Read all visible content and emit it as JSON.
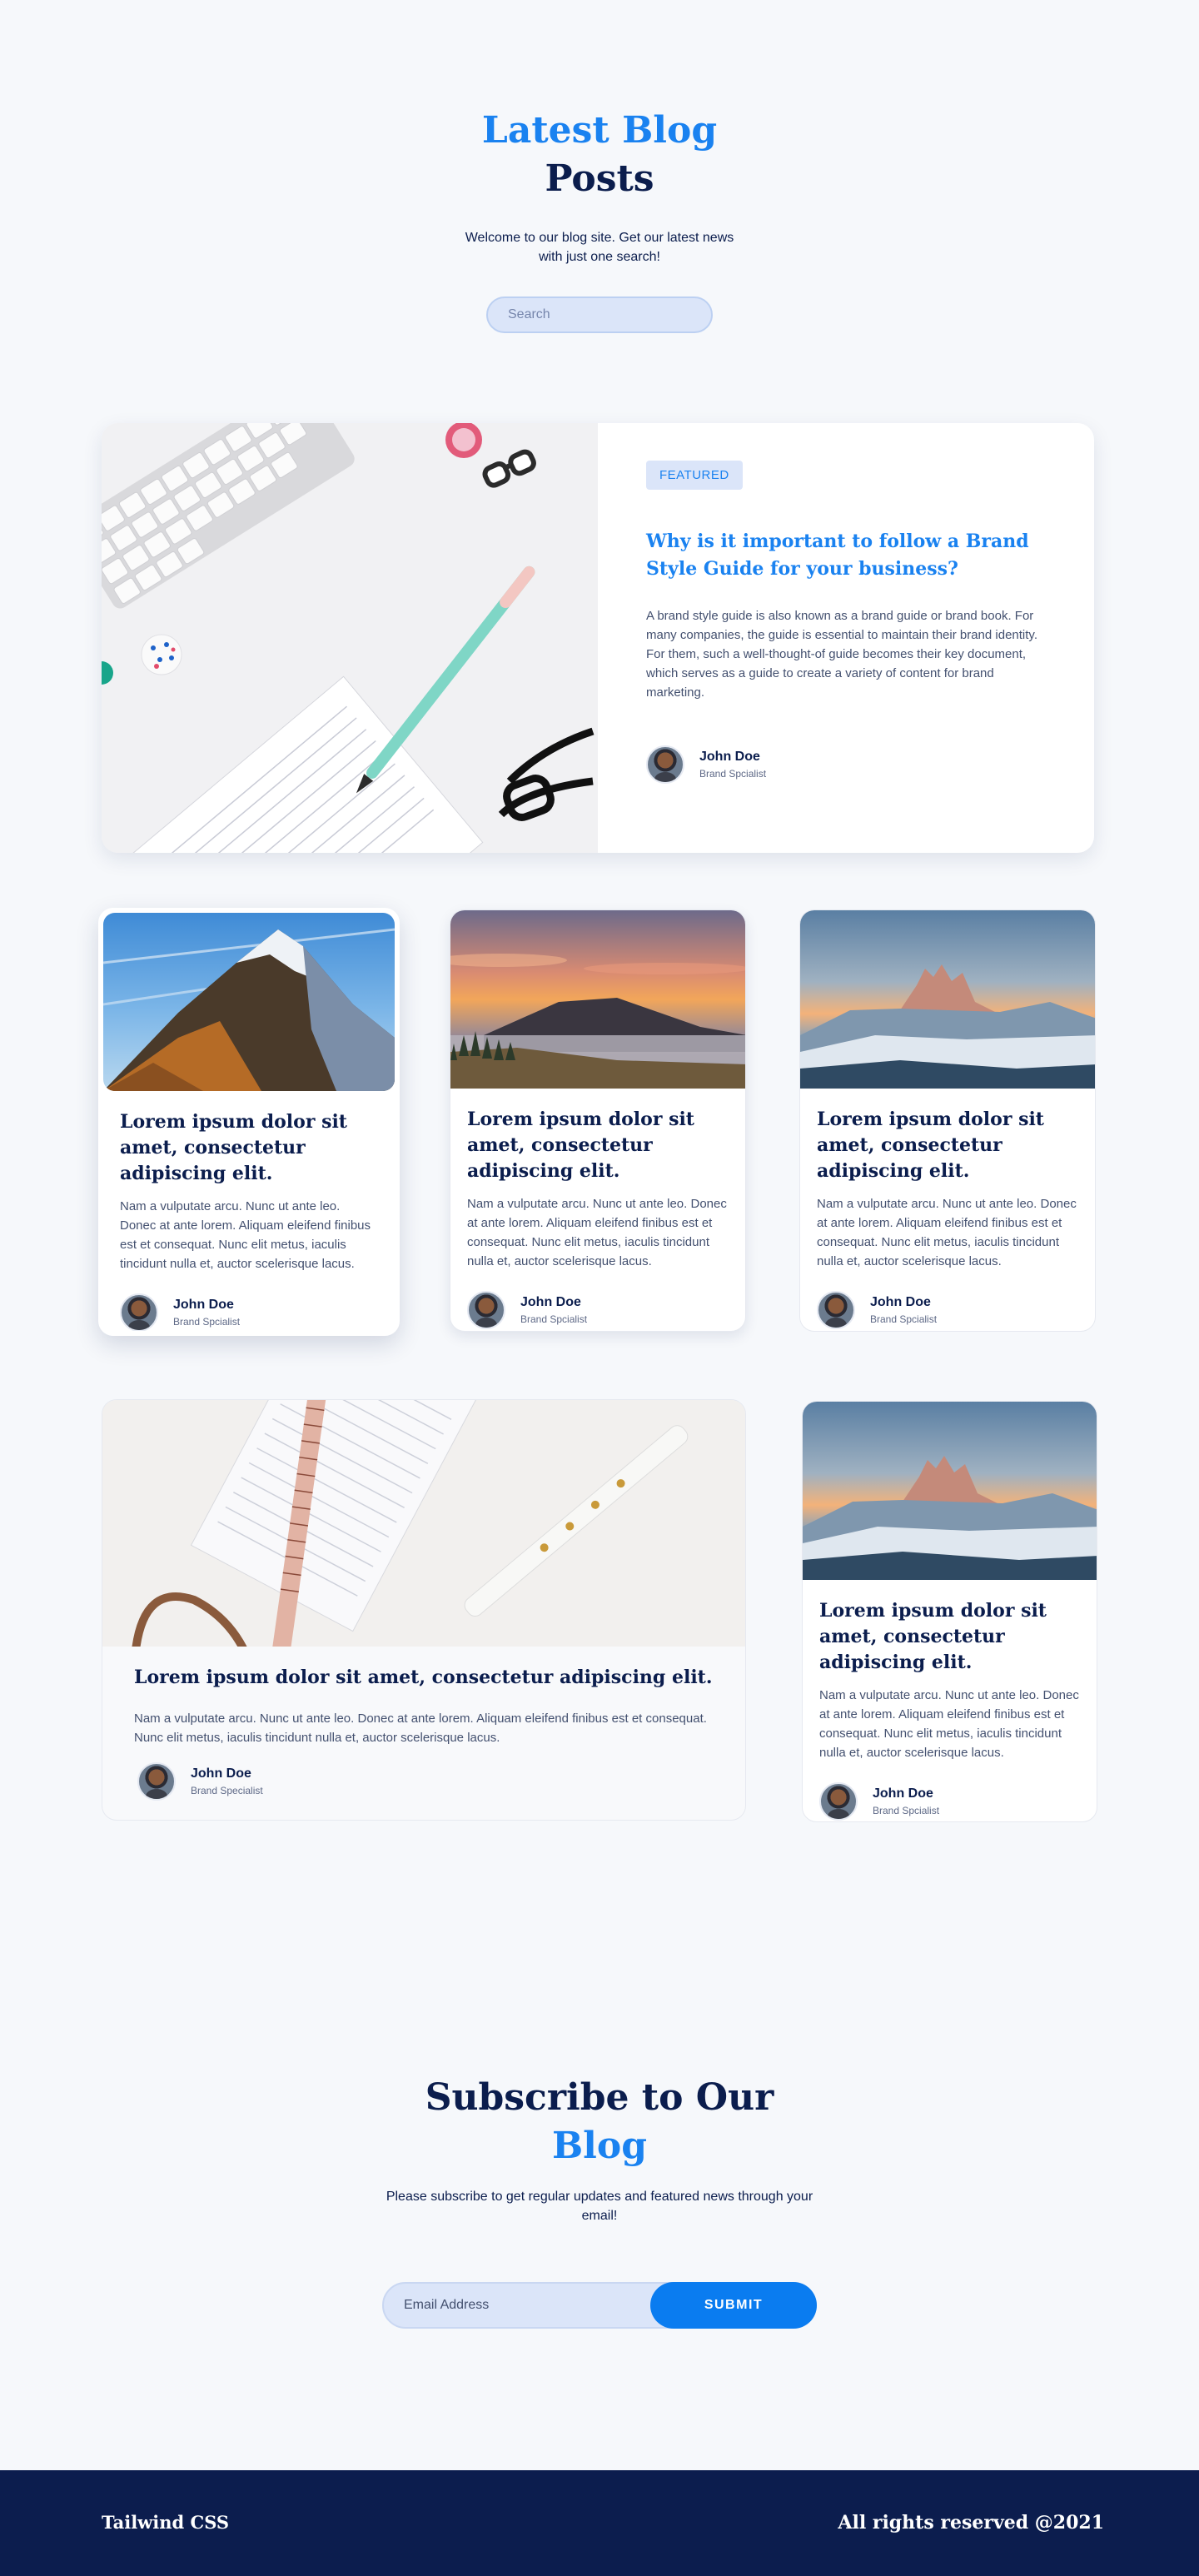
{
  "hero": {
    "title_blue": "Latest Blog",
    "title_dark": "Posts",
    "subtitle": "Welcome to our blog  site. Get our latest news with just one search!",
    "search_placeholder": "Search"
  },
  "featured": {
    "badge": "FEATURED",
    "title": "Why is it important to follow a Brand Style Guide for your business?",
    "description": "A brand style guide is also known as a brand guide or brand book. For many companies, the guide is essential to maintain their brand identity. For them, such a well-thought-of guide becomes their key document, which serves as a guide to create a variety of content for brand marketing.",
    "author": {
      "name": "John Doe",
      "role": "Brand Spcialist"
    }
  },
  "posts": [
    {
      "title": "Lorem ipsum dolor sit amet, consectetur adipiscing elit.",
      "excerpt": "Nam a vulputate arcu. Nunc ut ante leo. Donec at ante lorem. Aliquam eleifend finibus est et consequat. Nunc elit metus, iaculis tincidunt nulla et, auctor scelerisque lacus.",
      "author": {
        "name": "John Doe",
        "role": "Brand Spcialist"
      }
    },
    {
      "title": "Lorem ipsum dolor sit amet, consectetur adipiscing elit.",
      "excerpt": "Nam a vulputate arcu. Nunc ut ante leo. Donec at ante lorem. Aliquam eleifend finibus est et consequat. Nunc elit metus, iaculis tincidunt nulla et, auctor scelerisque lacus.",
      "author": {
        "name": "John Doe",
        "role": "Brand Spcialist"
      }
    },
    {
      "title": "Lorem ipsum dolor sit amet, consectetur adipiscing elit.",
      "excerpt": "Nam a vulputate arcu. Nunc ut ante leo. Donec at ante lorem. Aliquam eleifend finibus est et consequat. Nunc elit metus, iaculis tincidunt nulla et, auctor scelerisque lacus.",
      "author": {
        "name": "John Doe",
        "role": "Brand Spcialist"
      }
    },
    {
      "title": "Lorem ipsum dolor sit amet, consectetur adipiscing elit.",
      "excerpt": "Nam a vulputate arcu. Nunc ut ante leo. Donec at ante lorem. Aliquam eleifend finibus est et consequat. Nunc elit metus, iaculis tincidunt nulla et, auctor scelerisque lacus.",
      "author": {
        "name": "John Doe",
        "role": "Brand Specialist"
      }
    },
    {
      "title": "Lorem ipsum dolor sit amet, consectetur adipiscing elit.",
      "excerpt": "Nam a vulputate arcu. Nunc ut ante leo. Donec at ante lorem. Aliquam eleifend finibus est et consequat. Nunc elit metus, iaculis tincidunt nulla et, auctor scelerisque lacus.",
      "author": {
        "name": "John Doe",
        "role": "Brand Spcialist"
      }
    }
  ],
  "subscribe": {
    "title_dark": "Subscribe to Our",
    "title_blue": "Blog",
    "text": "Please subscribe to get regular updates and featured news through your email!",
    "email_placeholder": "Email Address",
    "submit_label": "SUBMIT"
  },
  "footer": {
    "brand": "Tailwind CSS",
    "rights": "All rights reserved @2021"
  },
  "colors": {
    "accent": "#1a82f0",
    "navy": "#0c1d4e",
    "background": "#f6f8fb",
    "input_bg": "#dbe5f9"
  }
}
